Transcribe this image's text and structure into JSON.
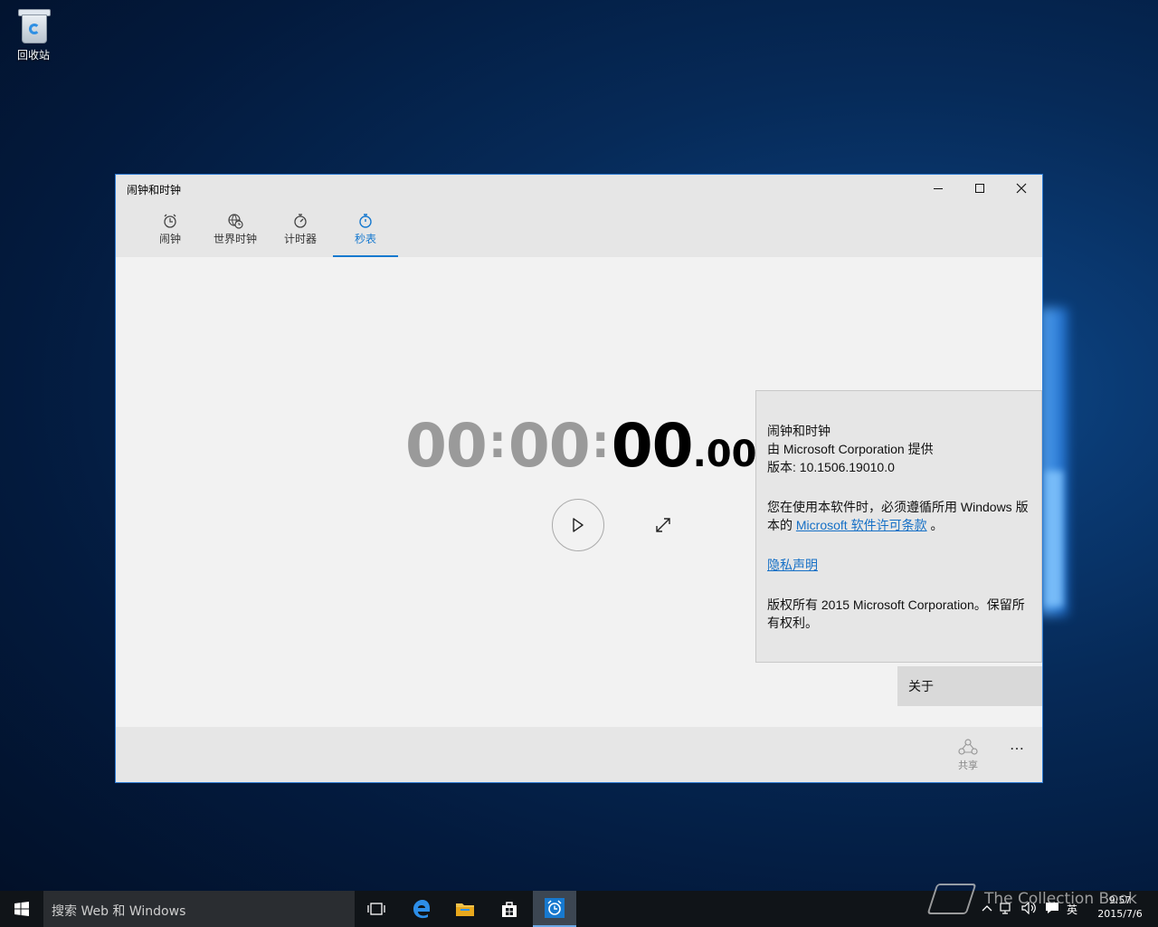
{
  "desktop": {
    "recycle_bin_label": "回收站"
  },
  "window": {
    "title": "闹钟和时钟",
    "tabs": [
      {
        "label": "闹钟",
        "icon": "alarm-clock-icon"
      },
      {
        "label": "世界时钟",
        "icon": "world-clock-icon"
      },
      {
        "label": "计时器",
        "icon": "timer-icon"
      },
      {
        "label": "秒表",
        "icon": "stopwatch-icon",
        "active": true
      }
    ],
    "stopwatch": {
      "hours": "00",
      "minutes": "00",
      "seconds": "00",
      "fraction": "00",
      "sep1": ":",
      "sep2": ":",
      "dot": "."
    },
    "bottombar": {
      "share_label": "共享",
      "more_label": "…"
    }
  },
  "about_flyout": {
    "app_name": "闹钟和时钟",
    "publisher": "由 Microsoft Corporation 提供",
    "version": "版本: 10.1506.19010.0",
    "license_prefix": "您在使用本软件时，必须遵循所用 Windows 版本的",
    "license_link": "Microsoft 软件许可条款",
    "license_suffix": "。",
    "privacy_link": "隐私声明",
    "copyright": "版权所有 2015 Microsoft Corporation。保留所有权利。"
  },
  "about_menu_item": "关于",
  "taskbar": {
    "search_placeholder": "搜索 Web 和 Windows",
    "ime_label": "英",
    "time": "9:57",
    "date": "2015/7/6",
    "accent_color": "#1779cf"
  },
  "watermark": "The Collection Book"
}
